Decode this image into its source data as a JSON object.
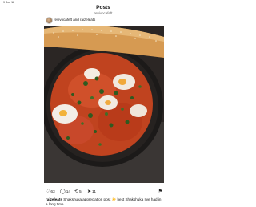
{
  "status_bar": {
    "time": "9 Dec 16"
  },
  "header": {
    "title": "Posts",
    "subtitle": "revivocafeft"
  },
  "post": {
    "authors": "revivocafeft and raizeleats",
    "more_label": "···",
    "actions": {
      "likes": "63",
      "comments": "14",
      "reposts": "5",
      "shares": "11"
    },
    "caption_user": "raizeleats",
    "caption_text": " Shakshuka appreciation post ☀️ best Shakshuka I’ve had in a long time"
  },
  "icons": [
    "avatar",
    "more-icon",
    "heart-icon",
    "comment-icon",
    "repost-icon",
    "share-icon",
    "bookmark-icon"
  ]
}
